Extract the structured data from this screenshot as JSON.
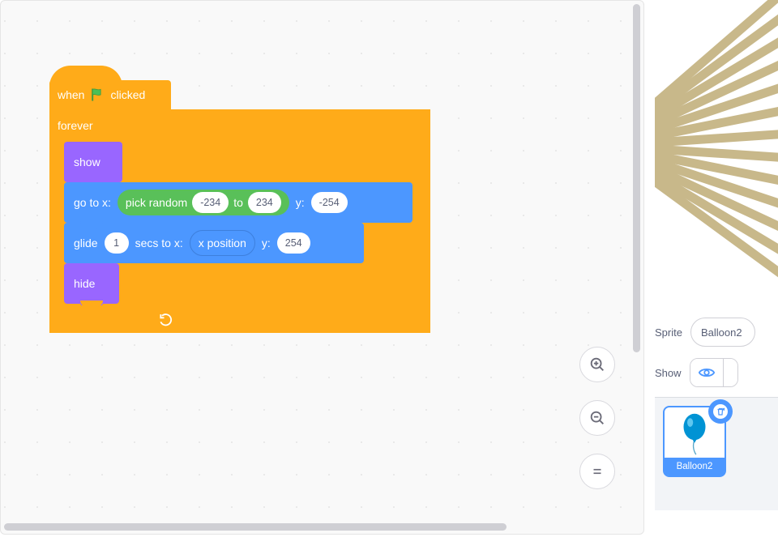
{
  "hat": {
    "prefix": "when",
    "suffix": "clicked"
  },
  "forever": {
    "label": "forever"
  },
  "show": {
    "label": "show"
  },
  "goto": {
    "prefix": "go to x:",
    "y_label": "y:",
    "y_val": "-254"
  },
  "random": {
    "prefix": "pick random",
    "from": "-234",
    "mid": "to",
    "to": "234"
  },
  "glide": {
    "prefix": "glide",
    "secs": "1",
    "secs_label": "secs to x:",
    "xpos": "x position",
    "y_label": "y:",
    "y_val": "254"
  },
  "hide": {
    "label": "hide"
  },
  "panel": {
    "sprite_label": "Sprite",
    "sprite_name": "Balloon2",
    "show_label": "Show"
  },
  "card": {
    "name": "Balloon2"
  }
}
